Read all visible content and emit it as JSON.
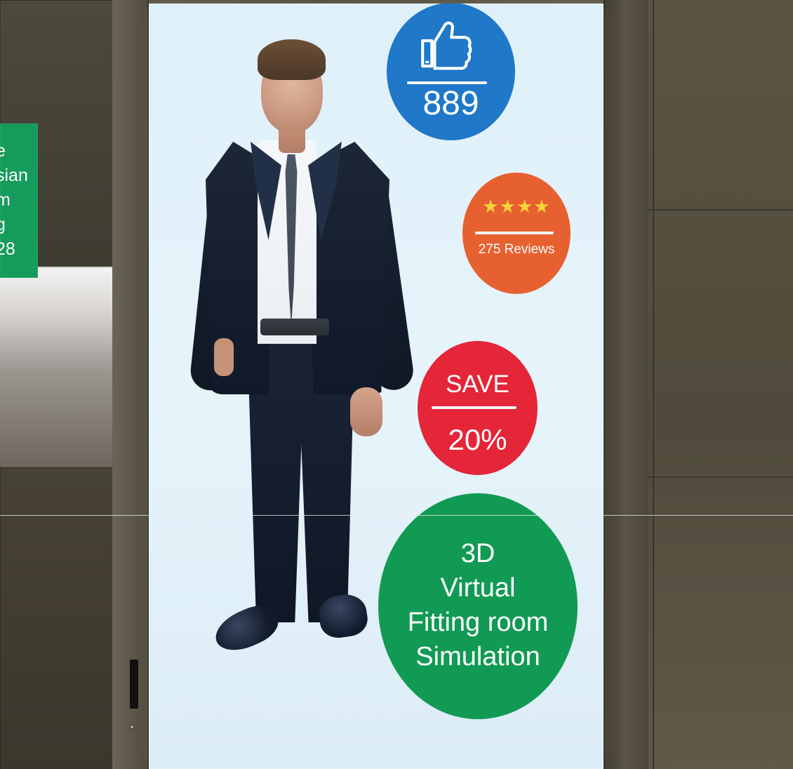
{
  "left_sign": {
    "lines": [
      "e",
      "sian",
      "m",
      "g",
      "28"
    ]
  },
  "badges": {
    "likes": {
      "icon": "thumbs-up-icon",
      "count": "889",
      "color": "#1f78c8"
    },
    "reviews": {
      "stars": "★★★★",
      "label": "275 Reviews",
      "color": "#e76030"
    },
    "save": {
      "top": "SAVE",
      "bottom": "20%",
      "color": "#e42638"
    },
    "fitting": {
      "lines": [
        "3D",
        "Virtual",
        "Fitting room",
        "Simulation"
      ],
      "color": "#119a53"
    }
  }
}
